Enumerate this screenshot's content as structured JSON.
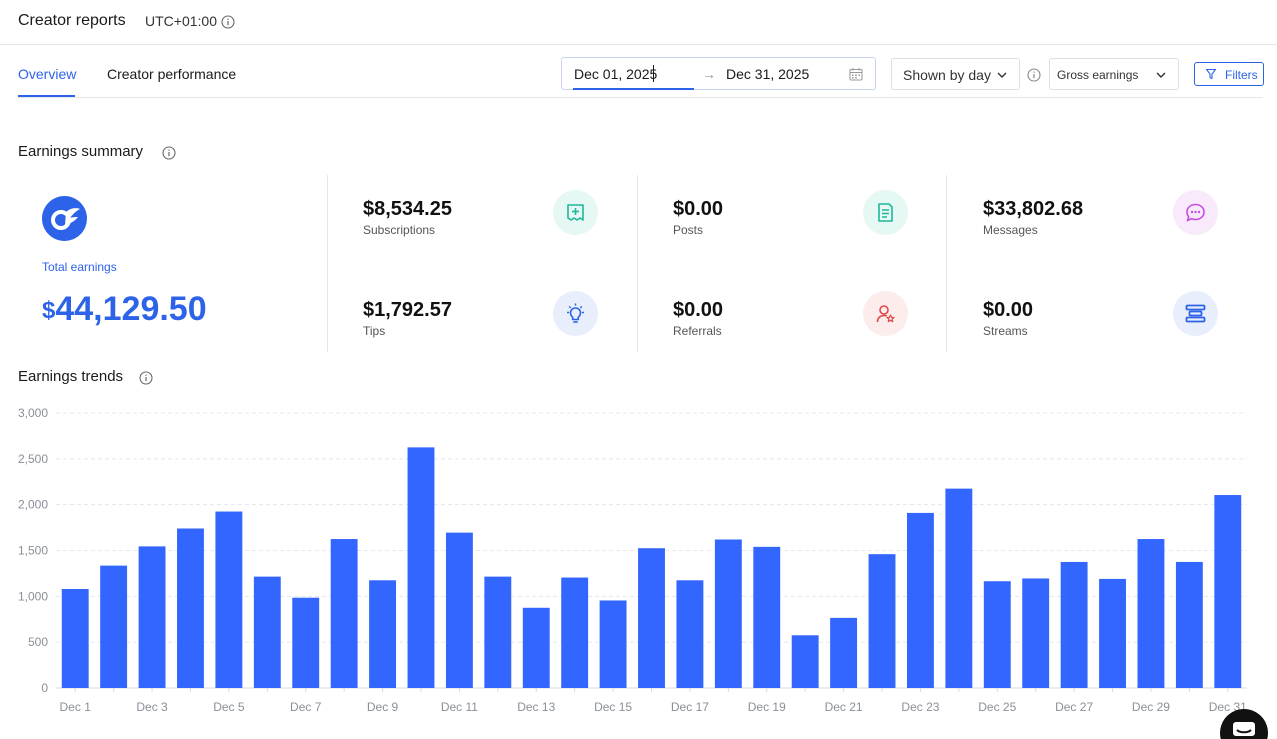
{
  "header": {
    "title": "Creator reports",
    "timezone": "UTC+01:00"
  },
  "tabs": [
    {
      "label": "Overview",
      "active": true
    },
    {
      "label": "Creator performance",
      "active": false
    }
  ],
  "date_range": {
    "start": "Dec 01, 2025",
    "arrow": "→",
    "end": "Dec 31, 2025"
  },
  "group_by": {
    "selected": "Shown by day"
  },
  "earnings_type": {
    "selected": "Gross earnings"
  },
  "filters_label": "Filters",
  "summary": {
    "title": "Earnings summary",
    "total_label": "Total earnings",
    "total_currency": "$",
    "total_value": "44,129.50",
    "metrics": [
      {
        "value": "$8,534.25",
        "label": "Subscriptions",
        "icon": "subscriptions-icon",
        "color": "#1fb89a"
      },
      {
        "value": "$0.00",
        "label": "Posts",
        "icon": "posts-icon",
        "color": "#1fb89a"
      },
      {
        "value": "$33,802.68",
        "label": "Messages",
        "icon": "messages-icon",
        "color": "#c350e0"
      },
      {
        "value": "$1,792.57",
        "label": "Tips",
        "icon": "tips-icon",
        "color": "#2d63e8"
      },
      {
        "value": "$0.00",
        "label": "Referrals",
        "icon": "referrals-icon",
        "color": "#e04848"
      },
      {
        "value": "$0.00",
        "label": "Streams",
        "icon": "streams-icon",
        "color": "#2d63e8"
      }
    ]
  },
  "trends_title": "Earnings trends",
  "colors": {
    "accent": "#2d63e8",
    "bar": "#3366ff"
  },
  "chart_data": {
    "type": "bar",
    "ylim": [
      0,
      3000
    ],
    "yticks": [
      "0",
      "500",
      "1,000",
      "1,500",
      "2,000",
      "2,500",
      "3,000"
    ],
    "ytick_values": [
      0,
      500,
      1000,
      1500,
      2000,
      2500,
      3000
    ],
    "categories": [
      "Dec 1",
      "Dec 2",
      "Dec 3",
      "Dec 4",
      "Dec 5",
      "Dec 6",
      "Dec 7",
      "Dec 8",
      "Dec 9",
      "Dec 10",
      "Dec 11",
      "Dec 12",
      "Dec 13",
      "Dec 14",
      "Dec 15",
      "Dec 16",
      "Dec 17",
      "Dec 18",
      "Dec 19",
      "Dec 20",
      "Dec 21",
      "Dec 22",
      "Dec 23",
      "Dec 24",
      "Dec 25",
      "Dec 26",
      "Dec 27",
      "Dec 28",
      "Dec 29",
      "Dec 30",
      "Dec 31"
    ],
    "xtick_labels": [
      "Dec 1",
      "Dec 3",
      "Dec 5",
      "Dec 7",
      "Dec 9",
      "Dec 11",
      "Dec 13",
      "Dec 15",
      "Dec 17",
      "Dec 19",
      "Dec 21",
      "Dec 23",
      "Dec 25",
      "Dec 27",
      "Dec 29",
      "Dec 31"
    ],
    "values": [
      1080,
      1335,
      1545,
      1740,
      1925,
      1215,
      985,
      1625,
      1175,
      2625,
      1695,
      1215,
      875,
      1205,
      955,
      1525,
      1175,
      1620,
      1540,
      575,
      765,
      1460,
      1910,
      2175,
      1165,
      1195,
      1375,
      1190,
      1625,
      1375,
      2105
    ],
    "grid": true
  }
}
